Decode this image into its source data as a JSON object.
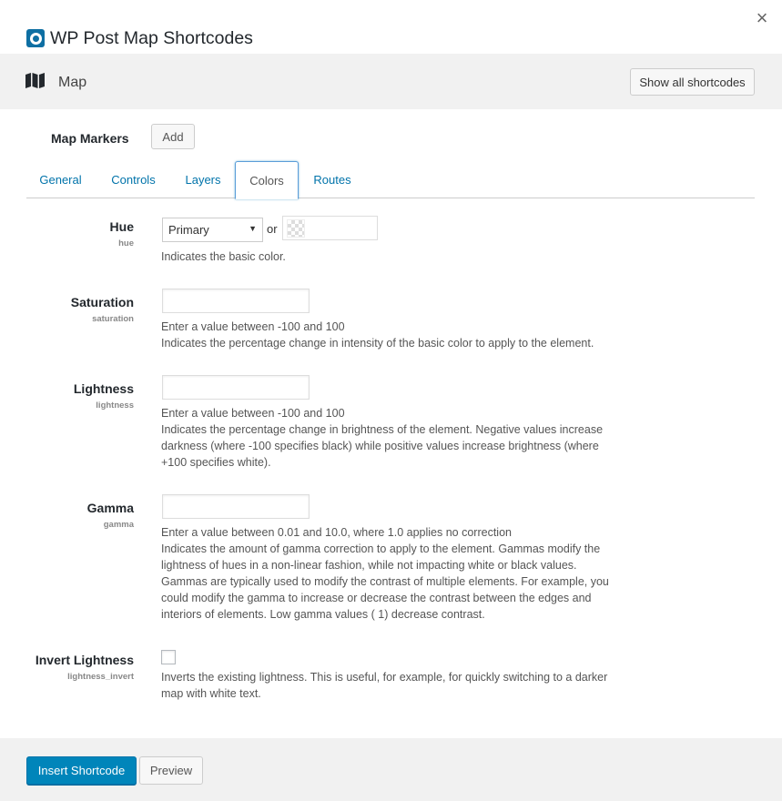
{
  "window": {
    "title": "WP Post Map Shortcodes",
    "close_label": "×"
  },
  "header": {
    "section_label": "Map",
    "show_all_label": "Show all shortcodes"
  },
  "markers": {
    "label": "Map Markers",
    "add_label": "Add"
  },
  "tabs": [
    {
      "label": "General",
      "active": false
    },
    {
      "label": "Controls",
      "active": false
    },
    {
      "label": "Layers",
      "active": false
    },
    {
      "label": "Colors",
      "active": true
    },
    {
      "label": "Routes",
      "active": false
    }
  ],
  "fields": {
    "hue": {
      "label": "Hue",
      "key": "hue",
      "select_value": "Primary",
      "or_text": "or",
      "desc": "Indicates the basic color."
    },
    "saturation": {
      "label": "Saturation",
      "key": "saturation",
      "value": "",
      "desc1": "Enter a value between -100 and 100",
      "desc2": "Indicates the percentage change in intensity of the basic color to apply to the element."
    },
    "lightness": {
      "label": "Lightness",
      "key": "lightness",
      "value": "",
      "desc1": "Enter a value between -100 and 100",
      "desc2": "Indicates the percentage change in brightness of the element. Negative values increase darkness (where -100 specifies black) while positive values increase brightness (where +100 specifies white)."
    },
    "gamma": {
      "label": "Gamma",
      "key": "gamma",
      "value": "",
      "desc1": "Enter a value between 0.01 and 10.0, where 1.0 applies no correction",
      "desc2": "Indicates the amount of gamma correction to apply to the element. Gammas modify the lightness of hues in a non-linear fashion, while not impacting white or black values. Gammas are typically used to modify the contrast of multiple elements. For example, you could modify the gamma to increase or decrease the contrast between the edges and interiors of elements. Low gamma values ( 1) decrease contrast."
    },
    "invert_lightness": {
      "label": "Invert Lightness",
      "key": "lightness_invert",
      "checked": false,
      "desc": "Inverts the existing lightness. This is useful, for example, for quickly switching to a darker map with white text."
    }
  },
  "footer": {
    "insert_label": "Insert Shortcode",
    "preview_label": "Preview"
  },
  "colors": {
    "primary_button": "#0085ba",
    "link": "#0073aa",
    "band": "#f1f1f1"
  }
}
